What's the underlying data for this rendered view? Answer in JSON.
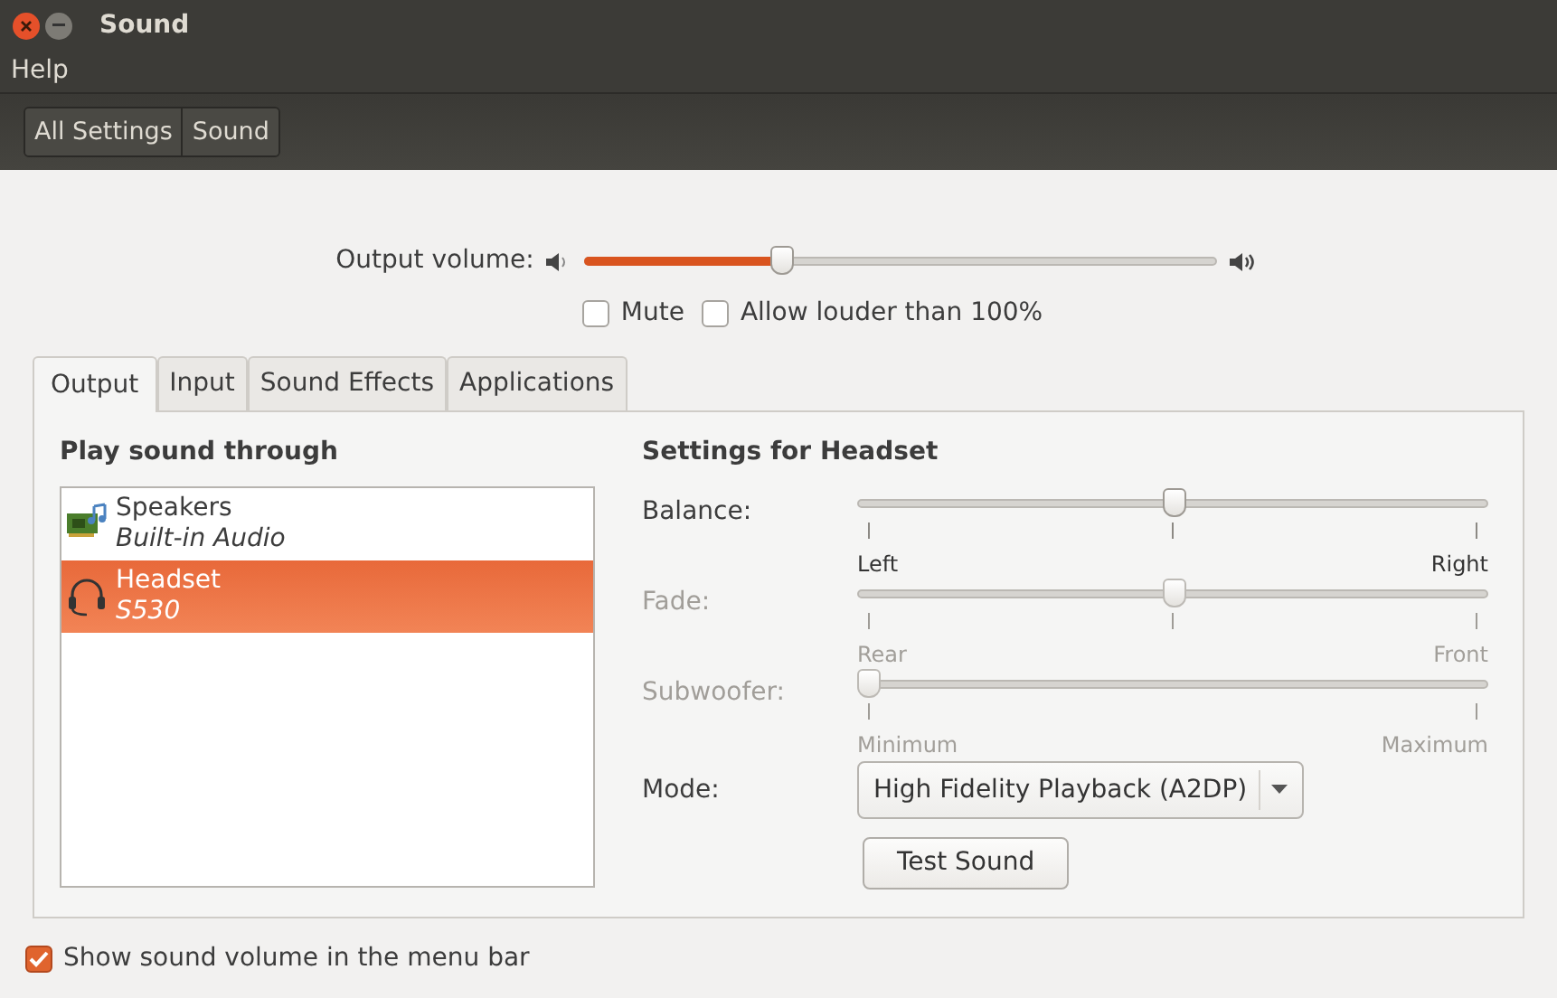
{
  "window": {
    "title": "Sound"
  },
  "menu": [
    "Help"
  ],
  "breadcrumbs": [
    {
      "label": "All Settings"
    },
    {
      "label": "Sound"
    }
  ],
  "output_volume": {
    "label": "Output volume:",
    "level": 0.31
  },
  "checks": [
    {
      "label": "Mute",
      "checked": false
    },
    {
      "label": "Allow louder than 100%",
      "checked": false
    }
  ],
  "tabs": [
    {
      "label": "Output",
      "selected": true
    },
    {
      "label": "Input",
      "selected": false
    },
    {
      "label": "Sound Effects",
      "selected": false
    },
    {
      "label": "Applications",
      "selected": false
    }
  ],
  "devices_heading": "Play sound through",
  "devices": [
    {
      "kind": "card",
      "name": "Speakers",
      "detail": "Built-in Audio",
      "selected": false
    },
    {
      "kind": "headset",
      "name": "Headset",
      "detail": "S530",
      "selected": true
    }
  ],
  "settings_heading": "Settings for Headset",
  "sliders": [
    {
      "label": "Balance:",
      "level": 0.5,
      "disabled": false,
      "min_label": "Left",
      "max_label": "Right",
      "center_tick": true
    },
    {
      "label": "Fade:",
      "level": 0.5,
      "disabled": true,
      "min_label": "Rear",
      "max_label": "Front",
      "center_tick": true
    },
    {
      "label": "Subwoofer:",
      "level": 0,
      "disabled": true,
      "min_label": "Minimum",
      "max_label": "Maximum",
      "center_tick": false
    }
  ],
  "mode": {
    "label": "Mode:",
    "value": "High Fidelity Playback (A2DP)"
  },
  "test_button": "Test Sound",
  "menu_bar_check": {
    "label": "Show sound volume in the menu bar",
    "checked": true
  }
}
